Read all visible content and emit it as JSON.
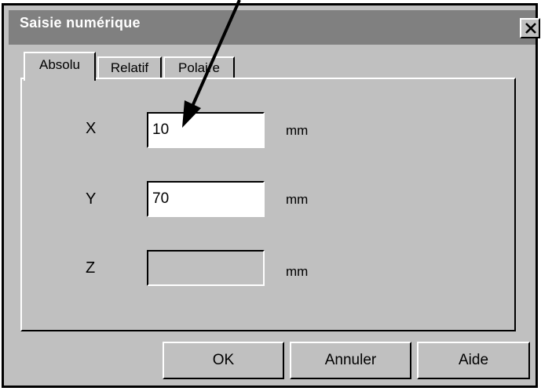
{
  "window": {
    "title": "Saisie numérique",
    "close_symbol": "×"
  },
  "tabs": [
    {
      "label": "Absolu",
      "active": true
    },
    {
      "label": "Relatif",
      "active": false
    },
    {
      "label": "Polaire",
      "active": false
    }
  ],
  "fields": {
    "x": {
      "label": "X",
      "value": "10",
      "unit": "mm",
      "enabled": true
    },
    "y": {
      "label": "Y",
      "value": "70",
      "unit": "mm",
      "enabled": true
    },
    "z": {
      "label": "Z",
      "value": "",
      "unit": "mm",
      "enabled": false
    }
  },
  "buttons": {
    "ok": "OK",
    "cancel": "Annuler",
    "help": "Aide"
  },
  "annotation": {
    "type": "arrow",
    "icon": "arrow-annotation",
    "color": "#000000"
  }
}
